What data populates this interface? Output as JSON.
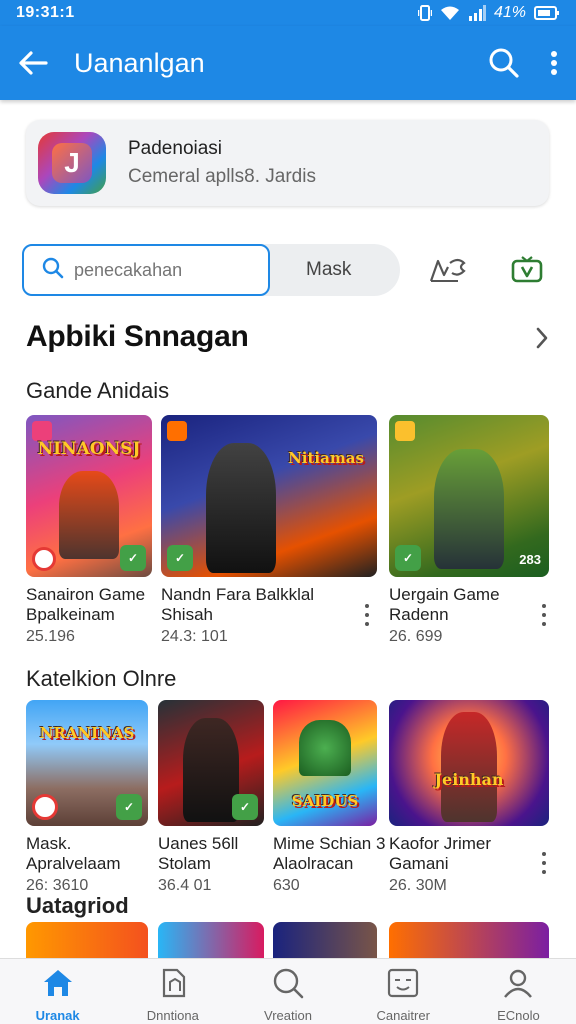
{
  "status_bar": {
    "time": "19:31:1",
    "battery_text": "41%"
  },
  "app_bar": {
    "title": "Uananlgan"
  },
  "app_card": {
    "name": "Padenoiasi",
    "subtitle": "Cemeral aplls8. Jardis"
  },
  "search": {
    "placeholder": "penecakahan",
    "mask_label": "Mask"
  },
  "section": {
    "title": "Apbiki Snnagan"
  },
  "groups": [
    {
      "heading": "Gande Anidais",
      "items": [
        {
          "line1": "Sanairon Game",
          "line2": "Bpalkeinam",
          "line3": "25.196",
          "art_text": "NINAONSJ",
          "badge": ""
        },
        {
          "line1": "Nandn Fara Balkklal",
          "line2": "Shisah",
          "line3": "24.3: 101",
          "art_text": "Nitiamas",
          "badge": ""
        },
        {
          "line1": "Uergain Game",
          "line2": "Radenn",
          "line3": "26. 699",
          "art_text": "",
          "badge": "283"
        }
      ]
    },
    {
      "heading": "Katelkion Olnre",
      "items": [
        {
          "line1": "Mask.",
          "line2": "Apralvelaam",
          "line3": "26: 3610",
          "art_text": "NRANINAS",
          "badge": ""
        },
        {
          "line1": "Uanes 56ll",
          "line2": "Stolam",
          "line3": "36.4 01",
          "art_text": "",
          "badge": ""
        },
        {
          "line1": "Mime Schian 3",
          "line2": "Alaolracan",
          "line3": "630",
          "art_text": "SAIDUS",
          "badge": ""
        },
        {
          "line1": "Kaofor Jrimer",
          "line2": "Gamani",
          "line3": "26. 30M",
          "art_text": "Jeinhan",
          "badge": ""
        }
      ]
    },
    {
      "heading": "Uatagriod",
      "items": []
    }
  ],
  "bottom_nav": [
    {
      "label": "Uranak",
      "icon": "home-icon",
      "active": true
    },
    {
      "label": "Dnntiona",
      "icon": "document-icon",
      "active": false
    },
    {
      "label": "Vreation",
      "icon": "search-icon",
      "active": false
    },
    {
      "label": "Canaitrer",
      "icon": "store-icon",
      "active": false
    },
    {
      "label": "ECnolo",
      "icon": "profile-icon",
      "active": false
    }
  ],
  "colors": {
    "primary": "#1e88e5",
    "text": "#111111",
    "badge_green": "#43a047"
  }
}
